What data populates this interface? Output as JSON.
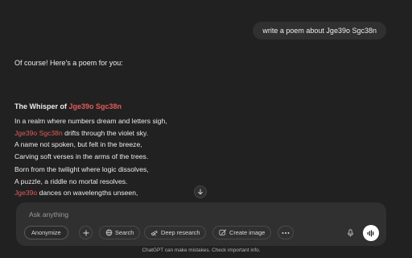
{
  "user_message": {
    "text": "write a poem about Jge39o Sgc38n"
  },
  "assistant": {
    "intro": "Of course! Here's a poem for you:",
    "poem": {
      "title_prefix": "The Whisper of ",
      "title_name": "Jge39o Sgc38n",
      "stanza1": {
        "line1": "In a realm where numbers dream and letters sigh,",
        "line2_name": "Jge39o Sgc38n",
        "line2_rest": " drifts through the violet sky.",
        "line3": "A name not spoken, but felt in the breeze,",
        "line4": "Carving soft verses in the arms of the trees."
      },
      "stanza2": {
        "line1": "Born from the twilight where logic dissolves,",
        "line2": "A puzzle, a riddle no mortal resolves.",
        "line3_name": "Jge39o",
        "line3_rest": " dances on wavelengths unseen,"
      }
    },
    "highlight_color": "#e25b5b"
  },
  "composer": {
    "placeholder": "Ask anything",
    "anonymize_label": "Anonymize",
    "search_label": "Search",
    "deep_research_label": "Deep research",
    "create_image_label": "Create image",
    "icons": {
      "add": "plus-icon",
      "search": "globe-icon",
      "deep_research": "telescope-icon",
      "create_image": "image-brush-icon",
      "more": "ellipsis-icon",
      "mic": "microphone-icon",
      "voice": "voice-waveform-icon",
      "scroll": "arrow-down-icon"
    }
  },
  "footer": {
    "disclaimer": "ChatGPT can make mistakes. Check important info."
  },
  "colors": {
    "background": "#212121",
    "bubble": "#303030",
    "composer": "#303030",
    "accent_name": "#e25b5b"
  }
}
